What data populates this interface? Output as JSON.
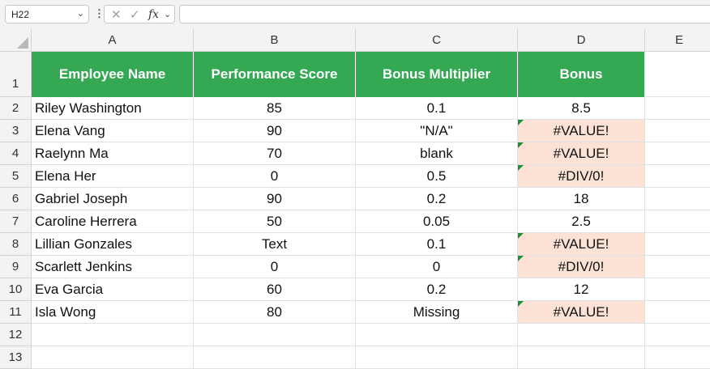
{
  "formula_bar": {
    "name_box": "H22",
    "formula": ""
  },
  "columns": [
    "A",
    "B",
    "C",
    "D",
    "E"
  ],
  "rows": [
    "1",
    "2",
    "3",
    "4",
    "5",
    "6",
    "7",
    "8",
    "9",
    "10",
    "11",
    "12",
    "13"
  ],
  "colors": {
    "header_fill": "#34a853",
    "error_fill": "#fbe2d5",
    "error_flag": "#1f8f3a"
  },
  "table": {
    "headers": [
      "Employee Name",
      "Performance Score",
      "Bonus Multiplier",
      "Bonus"
    ],
    "records": [
      {
        "name": "Riley Washington",
        "score": "85",
        "multiplier": "0.1",
        "bonus": "8.5",
        "error": false
      },
      {
        "name": "Elena Vang",
        "score": "90",
        "multiplier": "\"N/A\"",
        "bonus": "#VALUE!",
        "error": true
      },
      {
        "name": "Raelynn Ma",
        "score": "70",
        "multiplier": "blank",
        "bonus": "#VALUE!",
        "error": true
      },
      {
        "name": "Elena Her",
        "score": "0",
        "multiplier": "0.5",
        "bonus": "#DIV/0!",
        "error": true
      },
      {
        "name": "Gabriel Joseph",
        "score": "90",
        "multiplier": "0.2",
        "bonus": "18",
        "error": false
      },
      {
        "name": "Caroline Herrera",
        "score": "50",
        "multiplier": "0.05",
        "bonus": "2.5",
        "error": false
      },
      {
        "name": "Lillian Gonzales",
        "score": "Text",
        "multiplier": "0.1",
        "bonus": "#VALUE!",
        "error": true
      },
      {
        "name": "Scarlett Jenkins",
        "score": "0",
        "multiplier": "0",
        "bonus": "#DIV/0!",
        "error": true
      },
      {
        "name": "Eva Garcia",
        "score": "60",
        "multiplier": "0.2",
        "bonus": "12",
        "error": false
      },
      {
        "name": "Isla Wong",
        "score": "80",
        "multiplier": "Missing",
        "bonus": "#VALUE!",
        "error": true
      }
    ]
  }
}
